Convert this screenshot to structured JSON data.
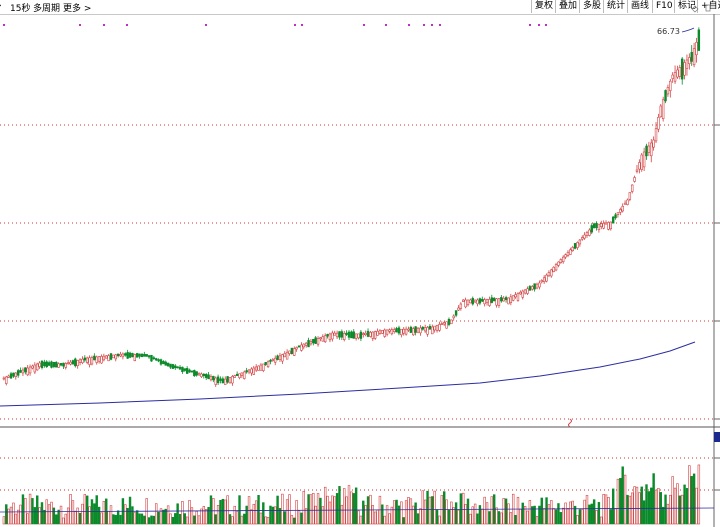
{
  "toolbar": {
    "seconds_label": "15秒",
    "multi_period_label": "多周期",
    "more_label": "更多",
    "more_arrow": ">",
    "restore_label": "复权",
    "overlay_label": "叠加",
    "multi_stock_label": "多股",
    "stats_label": "统计",
    "draw_line_label": "画线",
    "f10_label": "F10",
    "mark_label": "标记",
    "watchlist_label": "+自选"
  },
  "chart": {
    "last_price_label": "66.73",
    "colors": {
      "up": "#d24040",
      "down": "#0a8a2a",
      "ma": "#2a2ea0",
      "grid": "#cc3333",
      "event_dot": "#c030c0"
    },
    "event_dot_count": 19
  }
}
